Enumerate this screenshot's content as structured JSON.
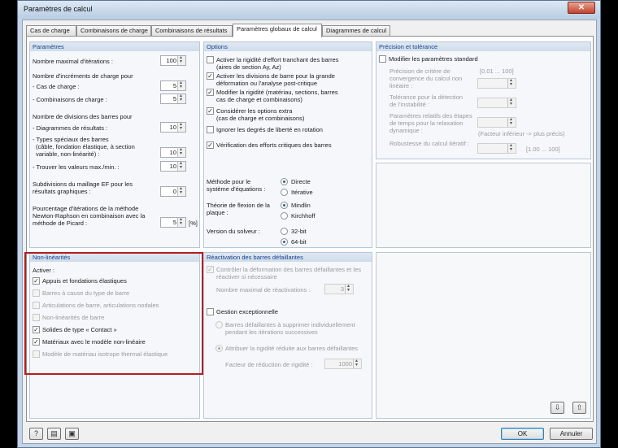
{
  "window": {
    "title": "Paramètres de calcul",
    "close": "✕"
  },
  "tabs": [
    "Cas de charge",
    "Combinaisons de charge",
    "Combinaisons de résultats",
    "Paramètres globaux de calcul",
    "Diagrammes de calcul"
  ],
  "parametres": {
    "title": "Paramètres",
    "max_iter_label": "Nombre maximal d'itérations :",
    "max_iter_value": "100",
    "incr_label": "Nombre d'incréments de charge pour",
    "cas_charge_label": "- Cas de charge :",
    "cas_charge_value": "5",
    "combi_charge_label": "- Combinaisons de charge :",
    "combi_charge_value": "5",
    "divisions_label": "Nombre de divisions des barres pour",
    "diag_label": "- Diagrammes de résultats :",
    "diag_value": "10",
    "types_label_1": "- Types spéciaux des barres",
    "types_label_2": "(câble, fondation élastique, à section",
    "types_label_3": "variable, non-linéarité) :",
    "types_value": "10",
    "maxmin_label": "- Trouver les valeurs max./min. :",
    "maxmin_value": "10",
    "subdiv_label_1": "Subdivisions du maillage EF pour les",
    "subdiv_label_2": "résultats graphiques :",
    "subdiv_value": "0",
    "pct_label_1": "Pourcentage d'itérations de la méthode",
    "pct_label_2": "Newton-Raphson en combinaison avec la",
    "pct_label_3": "méthode de Picard :",
    "pct_value": "5",
    "pct_unit": "[%]"
  },
  "options": {
    "title": "Options",
    "items": [
      {
        "l1": "Activer la rigidité d'effort tranchant des barres",
        "l2": "(aires de section Ay, Az)",
        "checked": false
      },
      {
        "l1": "Activer les divisions de barre pour la grande",
        "l2": "déformation ou l'analyse post-critique",
        "checked": true
      },
      {
        "l1": "Modifier la rigidité (matériau, sections, barres",
        "l2": "cas de charge et combinaisons)",
        "checked": true
      },
      {
        "l1": "Considérer les options extra",
        "l2": "(cas de charge et combinaisons)",
        "checked": true
      },
      {
        "l1": "Ignorer les degrés de liberté en rotation",
        "l2": "",
        "checked": false
      },
      {
        "l1": "Vérification des efforts critiques des barres",
        "l2": "",
        "checked": true
      }
    ],
    "method_label_1": "Méthode pour le",
    "method_label_2": "système d'équations :",
    "method_opts": [
      "Directe",
      "Itérative"
    ],
    "theory_label_1": "Théorie de flexion de la",
    "theory_label_2": "plaque :",
    "theory_opts": [
      "Mindlin",
      "Kirchhoff"
    ],
    "solver_label": "Version du solveur :",
    "solver_opts": [
      "32-bit",
      "64-bit"
    ]
  },
  "precision": {
    "title": "Précision et tolérance",
    "modify_label": "Modifier les paramètres standard",
    "conv_l1": "Précision de critère de",
    "conv_l2": "convergence du calcul non",
    "conv_l3": "linéaire :",
    "conv_range": "[0.01 ... 100]",
    "tol_l1": "Tolérance pour la détection",
    "tol_l2": "de l'instabilité :",
    "relax_l1": "Paramètres relatifs des étapes",
    "relax_l2": "de temps pour la relaxation",
    "relax_l3": "dynamique :",
    "relax_hint": "(Facteur inférieur -> plus précis)",
    "robust_label": "Robustesse du calcul itératif :",
    "robust_range": "[1.00 ... 100]"
  },
  "nonlin": {
    "title": "Non-linéarités",
    "activate": "Activer :",
    "items": [
      {
        "label": "Appuis et fondations élastiques",
        "checked": true,
        "enabled": true
      },
      {
        "label": "Barres à cause du type de barre",
        "checked": false,
        "enabled": false
      },
      {
        "label": "Articulations de barre, articulations nodales",
        "checked": false,
        "enabled": false
      },
      {
        "label": "Non-linéarités de barre",
        "checked": false,
        "enabled": false
      },
      {
        "label": "Solides de type « Contact »",
        "checked": true,
        "enabled": true
      },
      {
        "label": "Matériaux avec le modèle non-linéaire",
        "checked": true,
        "enabled": true
      },
      {
        "label": "Modèle de matériau isotrope thermal élastique",
        "checked": false,
        "enabled": false
      }
    ]
  },
  "reactivation": {
    "title": "Réactivation des barres défaillantes",
    "control_l1": "Contrôler la déformation des barres défaillantes et les",
    "control_l2": "réactiver si nécessaire",
    "max_label": "Nombre maximal de réactivations :",
    "max_value": "3",
    "gestion_label": "Gestion exceptionnelle",
    "opt1_l1": "Barres défaillantes à supprimer individuellement",
    "opt1_l2": "pendant les itérations successives",
    "opt2": "Attribuer la rigidité réduite aux barres défaillantes",
    "factor_label": "Facteur de réduction de rigidité :",
    "factor_value": "1000"
  },
  "footer": {
    "ok": "OK",
    "cancel": "Annuler"
  }
}
